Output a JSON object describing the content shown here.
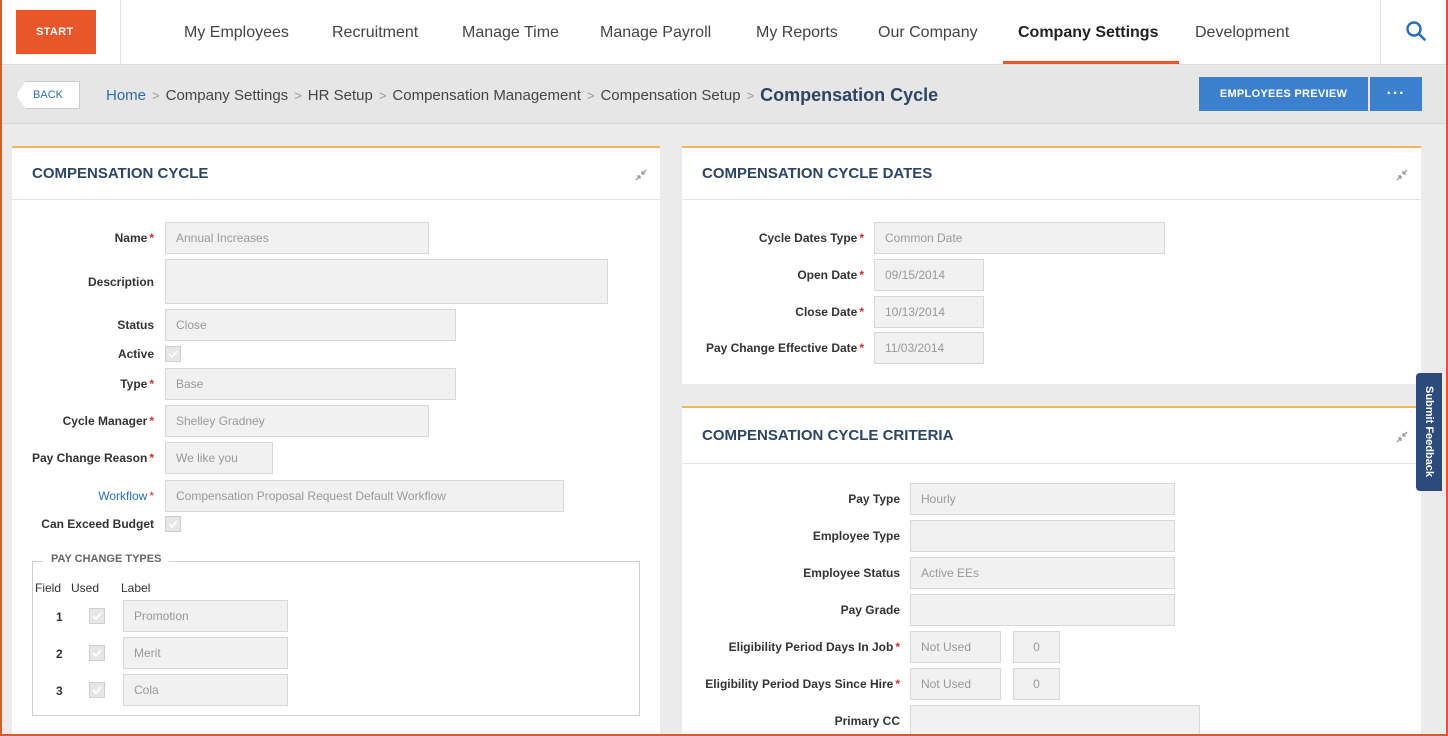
{
  "nav": {
    "start": "START",
    "items": [
      "My Employees",
      "Recruitment",
      "Manage Time",
      "Manage Payroll",
      "My Reports",
      "Our Company",
      "Company Settings",
      "Development"
    ],
    "active_index": 6,
    "search_icon": "search-icon"
  },
  "breadcrumb": {
    "back": "BACK",
    "items": [
      "Home",
      "Company Settings",
      "HR Setup",
      "Compensation Management",
      "Compensation Setup"
    ],
    "current": "Compensation Cycle",
    "preview_button": "EMPLOYEES PREVIEW",
    "more_button": "···"
  },
  "colors": {
    "accent": "#e8562a",
    "primary_button": "#3c7fcf",
    "panel_title": "#2c4563",
    "panel_top_border": "#f0b85a",
    "link": "#2a6db5",
    "required": "#d03030"
  },
  "comp_cycle": {
    "title": "COMPENSATION CYCLE",
    "fields": {
      "name": {
        "label": "Name",
        "value": "Annual Increases"
      },
      "description": {
        "label": "Description",
        "value": ""
      },
      "status": {
        "label": "Status",
        "value": "Close"
      },
      "active": {
        "label": "Active",
        "checked": true
      },
      "type": {
        "label": "Type",
        "value": "Base"
      },
      "cycle_manager": {
        "label": "Cycle Manager",
        "value": "Shelley Gradney"
      },
      "pay_change_reason": {
        "label": "Pay Change Reason",
        "value": "We like you"
      },
      "workflow": {
        "label": "Workflow",
        "value": "Compensation Proposal Request Default Workflow"
      },
      "can_exceed_budget": {
        "label": "Can Exceed Budget",
        "checked": true
      }
    },
    "pay_change_types": {
      "legend": "PAY CHANGE TYPES",
      "headers": {
        "field": "Field",
        "used": "Used",
        "label": "Label"
      },
      "rows": [
        {
          "field": "1",
          "used": true,
          "label": "Promotion"
        },
        {
          "field": "2",
          "used": true,
          "label": "Merit"
        },
        {
          "field": "3",
          "used": true,
          "label": "Cola"
        }
      ]
    }
  },
  "cycle_dates": {
    "title": "COMPENSATION CYCLE DATES",
    "fields": {
      "cycle_dates_type": {
        "label": "Cycle Dates Type",
        "value": "Common Date"
      },
      "open_date": {
        "label": "Open Date",
        "value": "09/15/2014"
      },
      "close_date": {
        "label": "Close Date",
        "value": "10/13/2014"
      },
      "pay_change_effective_date": {
        "label": "Pay Change Effective Date",
        "value": "11/03/2014"
      }
    }
  },
  "cycle_criteria": {
    "title": "COMPENSATION CYCLE CRITERIA",
    "fields": {
      "pay_type": {
        "label": "Pay Type",
        "value": "Hourly"
      },
      "employee_type": {
        "label": "Employee Type",
        "value": ""
      },
      "employee_status": {
        "label": "Employee Status",
        "value": "Active EEs"
      },
      "pay_grade": {
        "label": "Pay Grade",
        "value": ""
      },
      "elig_days_in_job": {
        "label": "Eligibility Period Days In Job",
        "value": "Not Used",
        "days": "0"
      },
      "elig_days_since_hire": {
        "label": "Eligibility Period Days Since Hire",
        "value": "Not Used",
        "days": "0"
      },
      "primary_cc": {
        "label": "Primary CC",
        "value": ""
      }
    }
  },
  "feedback_tab": "Submit Feedback"
}
